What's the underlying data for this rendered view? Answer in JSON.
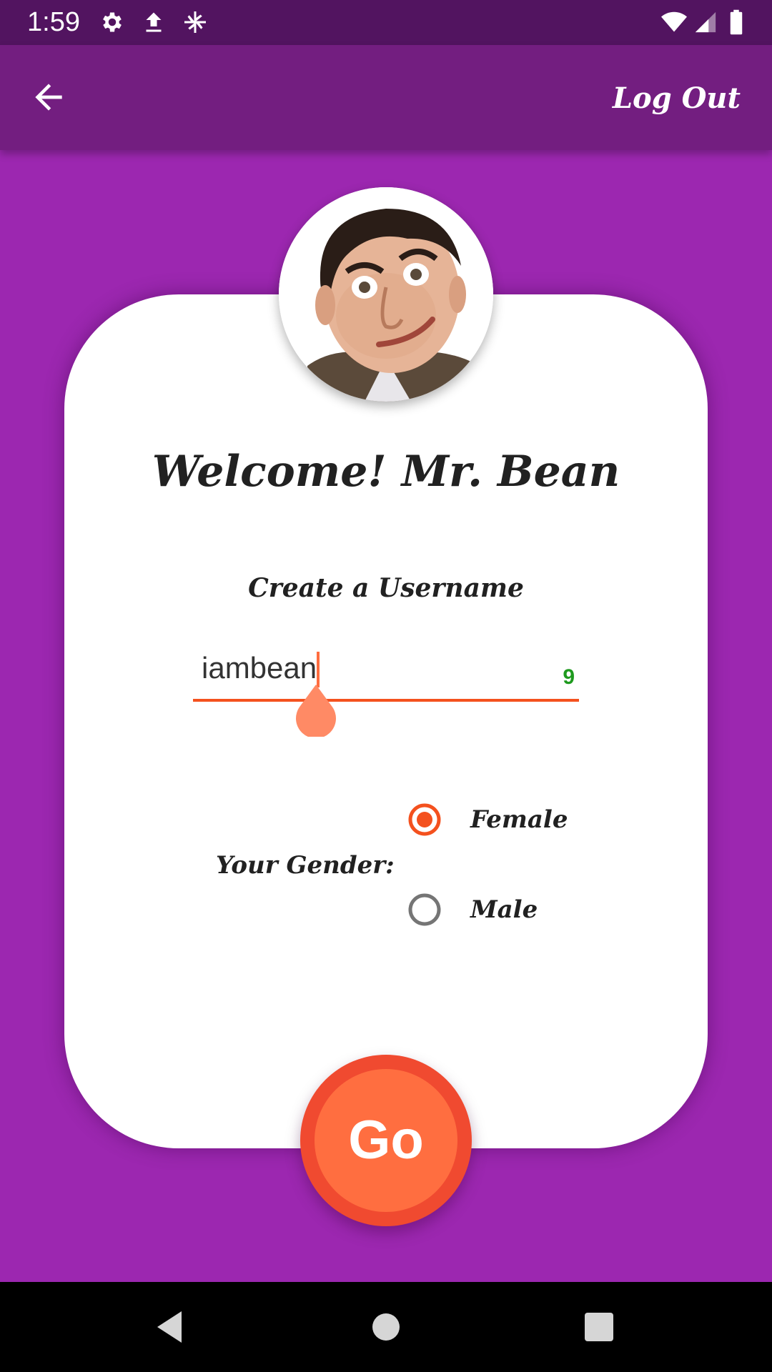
{
  "status_bar": {
    "time": "1:59",
    "icons": [
      "settings-icon",
      "upload-icon",
      "pinwheel-icon",
      "wifi-icon",
      "cell-signal-icon",
      "battery-icon"
    ]
  },
  "app_bar": {
    "back_icon": "arrow-back-icon",
    "logout_label": "Log Out"
  },
  "profile": {
    "avatar": "profile-photo",
    "welcome_text": "Welcome! Mr. Bean"
  },
  "username": {
    "label": "Create a Username",
    "value": "iambean",
    "counter": "9"
  },
  "gender": {
    "label": "Your Gender:",
    "options": [
      {
        "label": "Female",
        "selected": true
      },
      {
        "label": "Male",
        "selected": false
      }
    ]
  },
  "go_button": {
    "label": "Go"
  },
  "nav_bar": {
    "icons": [
      "back-triangle-icon",
      "home-circle-icon",
      "recents-square-icon"
    ]
  },
  "colors": {
    "background": "#9c27b0",
    "app_bar": "#731e80",
    "status_bar": "#521460",
    "accent": "#ff6e40",
    "accent_dark": "#f04a30",
    "counter": "#1e9a1e"
  }
}
